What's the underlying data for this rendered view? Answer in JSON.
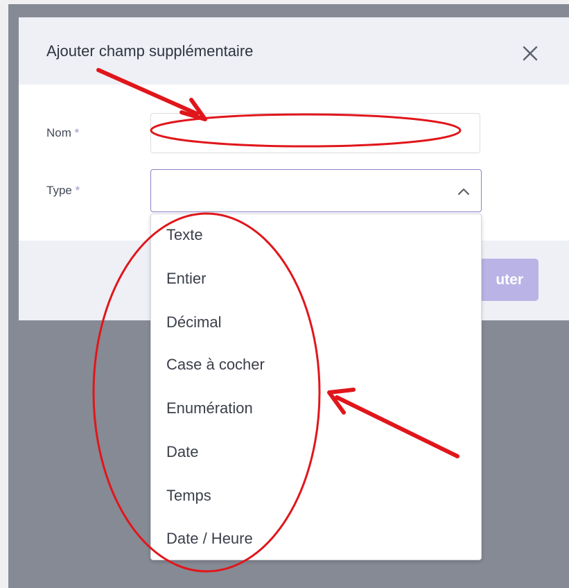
{
  "modal": {
    "title": "Ajouter champ supplémentaire",
    "close_icon": "close-icon",
    "fields": {
      "nom": {
        "label": "Nom",
        "required_mark": "*",
        "value": ""
      },
      "type": {
        "label": "Type",
        "required_mark": "*",
        "value": "",
        "chevron_icon": "chevron-up-icon"
      }
    },
    "footer": {
      "add_button_label": "uter"
    }
  },
  "dropdown": {
    "options": [
      "Texte",
      "Entier",
      "Décimal",
      "Case à cocher",
      "Enumération",
      "Date",
      "Temps",
      "Date / Heure"
    ]
  },
  "colors": {
    "overlay": "#868a94",
    "modal_header_bg": "#eef0f6",
    "accent": "#8a80c9",
    "add_button": "#b9b3e6",
    "annotation": "#e0161b"
  }
}
